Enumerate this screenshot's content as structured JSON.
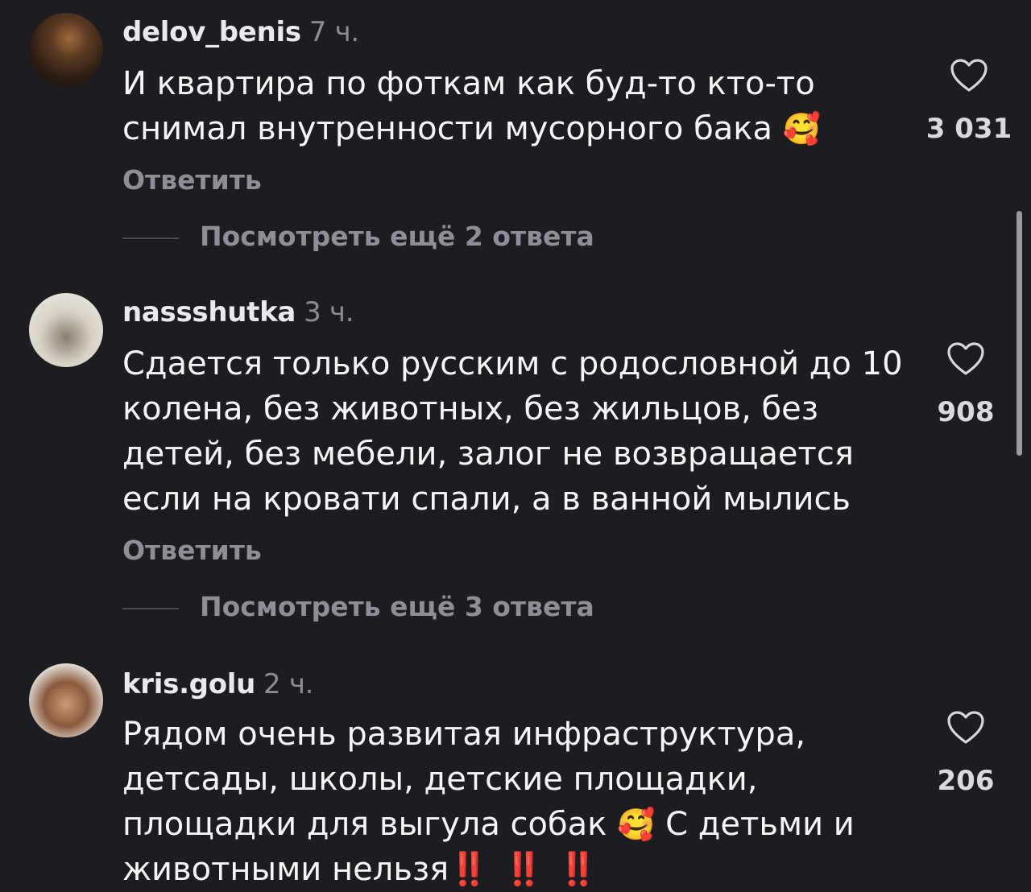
{
  "comments": [
    {
      "username": "delov_benis",
      "time": "7 ч.",
      "text": "И квартира по фоткам как буд-то кто-то снимал внутренности мусорного бака",
      "emoji": "🥰",
      "likes": "3 031",
      "reply_label": "Ответить",
      "more_replies": "Посмотреть ещё 2 ответа"
    },
    {
      "username": "nassshutka",
      "time": "3 ч.",
      "text": "Сдается только русским с родословной до 10 колена, без животных, без жильцов, без детей, без мебели, залог не возвращается если на кровати спали, а в ванной мылись",
      "likes": "908",
      "reply_label": "Ответить",
      "more_replies": "Посмотреть ещё 3 ответа"
    },
    {
      "username": "kris.golu",
      "time": "2 ч.",
      "text_part1": "Рядом очень развитая инфраструктура, детсады, школы, детские площадки, площадки для выгула собак",
      "emoji": "🥰",
      "text_part2": "С детьми и животными нельзя",
      "bangs": "‼️ ‼️ ‼️",
      "likes": "206"
    }
  ],
  "icons": {
    "like": "heart-outline-icon"
  },
  "colors": {
    "background": "#1c1c21",
    "text": "#f5f5f7",
    "muted": "#8e8e96",
    "accent_bang": "#e0241b"
  }
}
